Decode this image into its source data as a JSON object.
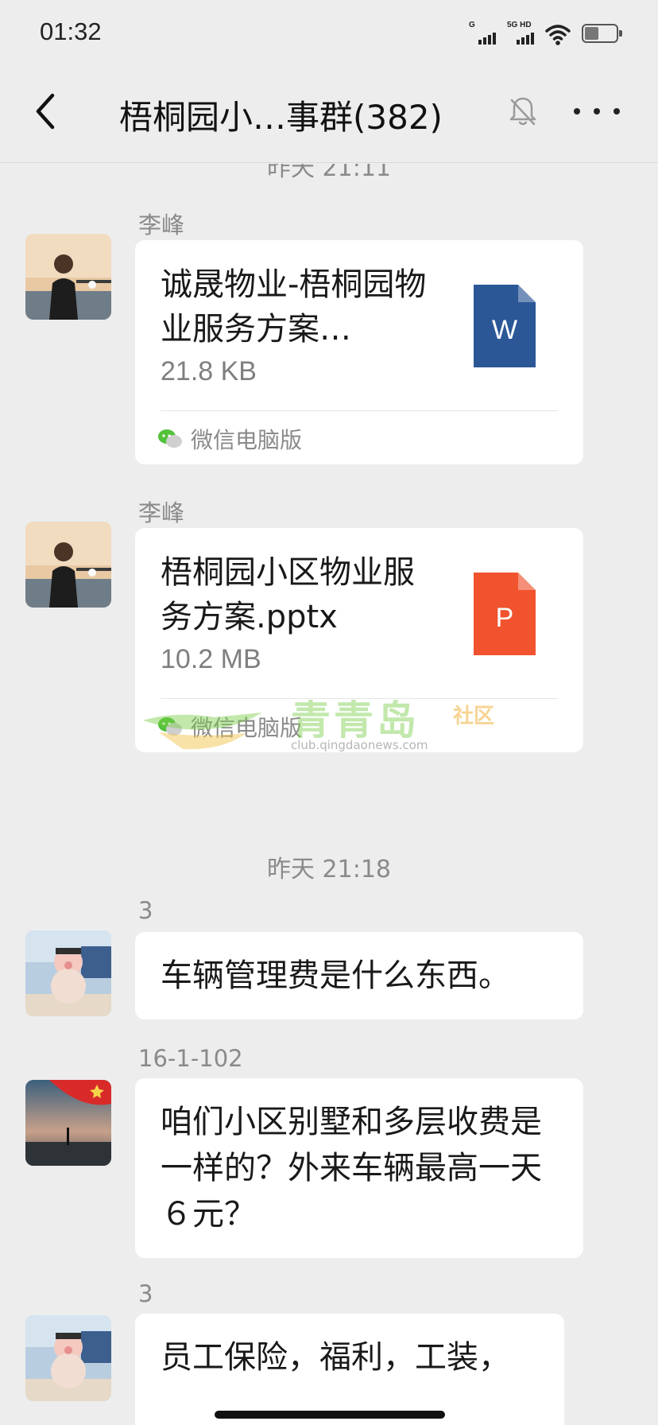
{
  "status_bar": {
    "time": "01:32",
    "sim1_label": "G",
    "sim2_label": "5G HD",
    "battery_level": 0.45
  },
  "header": {
    "title": "梧桐园小…事群(382)",
    "back_icon": "chevron-left-icon",
    "mute_icon": "bell-off-icon",
    "more_icon": "more-horizontal-icon"
  },
  "messages": {
    "top_time_separator": "昨天 21:11",
    "m1": {
      "sender": "李峰",
      "file_name": "诚晟物业-梧桐园物业服务方案…",
      "file_size": "21.8 KB",
      "file_type_letter": "W",
      "file_type_color": "#2b5797",
      "source": "微信电脑版"
    },
    "m2": {
      "sender": "李峰",
      "file_name": "梧桐园小区物业服务方案.pptx",
      "file_size": "10.2 MB",
      "file_type_letter": "P",
      "file_type_color": "#f0532e",
      "source": "微信电脑版"
    },
    "time_separator": "昨天 21:18",
    "m3": {
      "sender": "3",
      "text": "车辆管理费是什么东西。"
    },
    "m4": {
      "sender": "16-1-102",
      "text": "咱们小区别墅和多层收费是一样的？外来车辆最高一天６元？"
    },
    "m5": {
      "sender": "3",
      "text": "员工保险，福利，工装，"
    }
  },
  "watermark": {
    "title": "青青岛",
    "subtitle": "社区",
    "url": "club.qingdaonews.com"
  }
}
